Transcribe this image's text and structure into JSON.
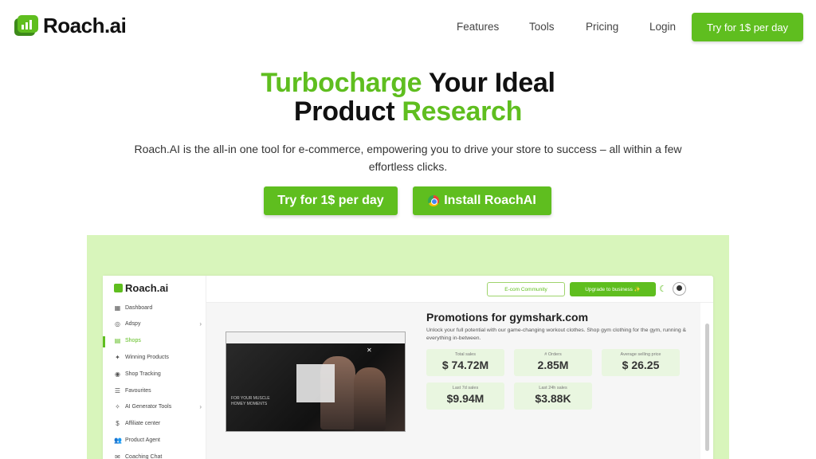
{
  "brand": {
    "name": "Roach.ai"
  },
  "nav": {
    "links": [
      "Features",
      "Tools",
      "Pricing",
      "Login"
    ],
    "cta": "Try for 1$ per day"
  },
  "hero": {
    "line1_green": "Turbocharge",
    "line1_black": " Your Ideal",
    "line2_black": "Product ",
    "line2_green": "Research",
    "subtitle": "Roach.AI is the all-in one tool for e-commerce, empowering you to drive your store to success – all within a few effortless clicks.",
    "btn_try": "Try for 1$ per day",
    "btn_install": "Install RoachAI"
  },
  "app": {
    "logo": "Roach.ai",
    "sidebar": [
      {
        "label": "Dashboard",
        "icon": "grid-icon",
        "glyph": "▦"
      },
      {
        "label": "Adspy",
        "icon": "eye-icon",
        "glyph": "◎",
        "chevron": true
      },
      {
        "label": "Shops",
        "icon": "shop-icon",
        "glyph": "▤",
        "active": true
      },
      {
        "label": "Winning Products",
        "icon": "sparkle-icon",
        "glyph": "✦"
      },
      {
        "label": "Shop Tracking",
        "icon": "target-icon",
        "glyph": "◉"
      },
      {
        "label": "Favourites",
        "icon": "list-icon",
        "glyph": "☰"
      },
      {
        "label": "AI Generator Tools",
        "icon": "ai-icon",
        "glyph": "✧",
        "chevron": true
      },
      {
        "label": "Affiliate center",
        "icon": "dollar-icon",
        "glyph": "$"
      },
      {
        "label": "Product Agent",
        "icon": "users-icon",
        "glyph": "👥"
      },
      {
        "label": "Coaching Chat",
        "icon": "chat-icon",
        "glyph": "✉"
      }
    ],
    "top": {
      "community": "E-com Community",
      "upgrade": "Upgrade to business ✨"
    },
    "promo": {
      "title": "Promotions for gymshark.com",
      "desc": "Unlock your full potential with our game-changing workout clothes. Shop gym clothing for the gym, running & everything in-between.",
      "video_text": "FOR YOUR MUSCLE\nHOMEY MOMENTS"
    },
    "stats": [
      {
        "label": "Total sales",
        "value": "$ 74.72M"
      },
      {
        "label": "# Orders",
        "value": "2.85M"
      },
      {
        "label": "Average selling price",
        "value": "$ 26.25"
      },
      {
        "label": "Last 7d sales",
        "value": "$9.94M"
      },
      {
        "label": "Last 24h sales",
        "value": "$3.88K"
      }
    ]
  },
  "colors": {
    "accent": "#5fbe1f",
    "preview_bg": "#d8f5bb"
  }
}
